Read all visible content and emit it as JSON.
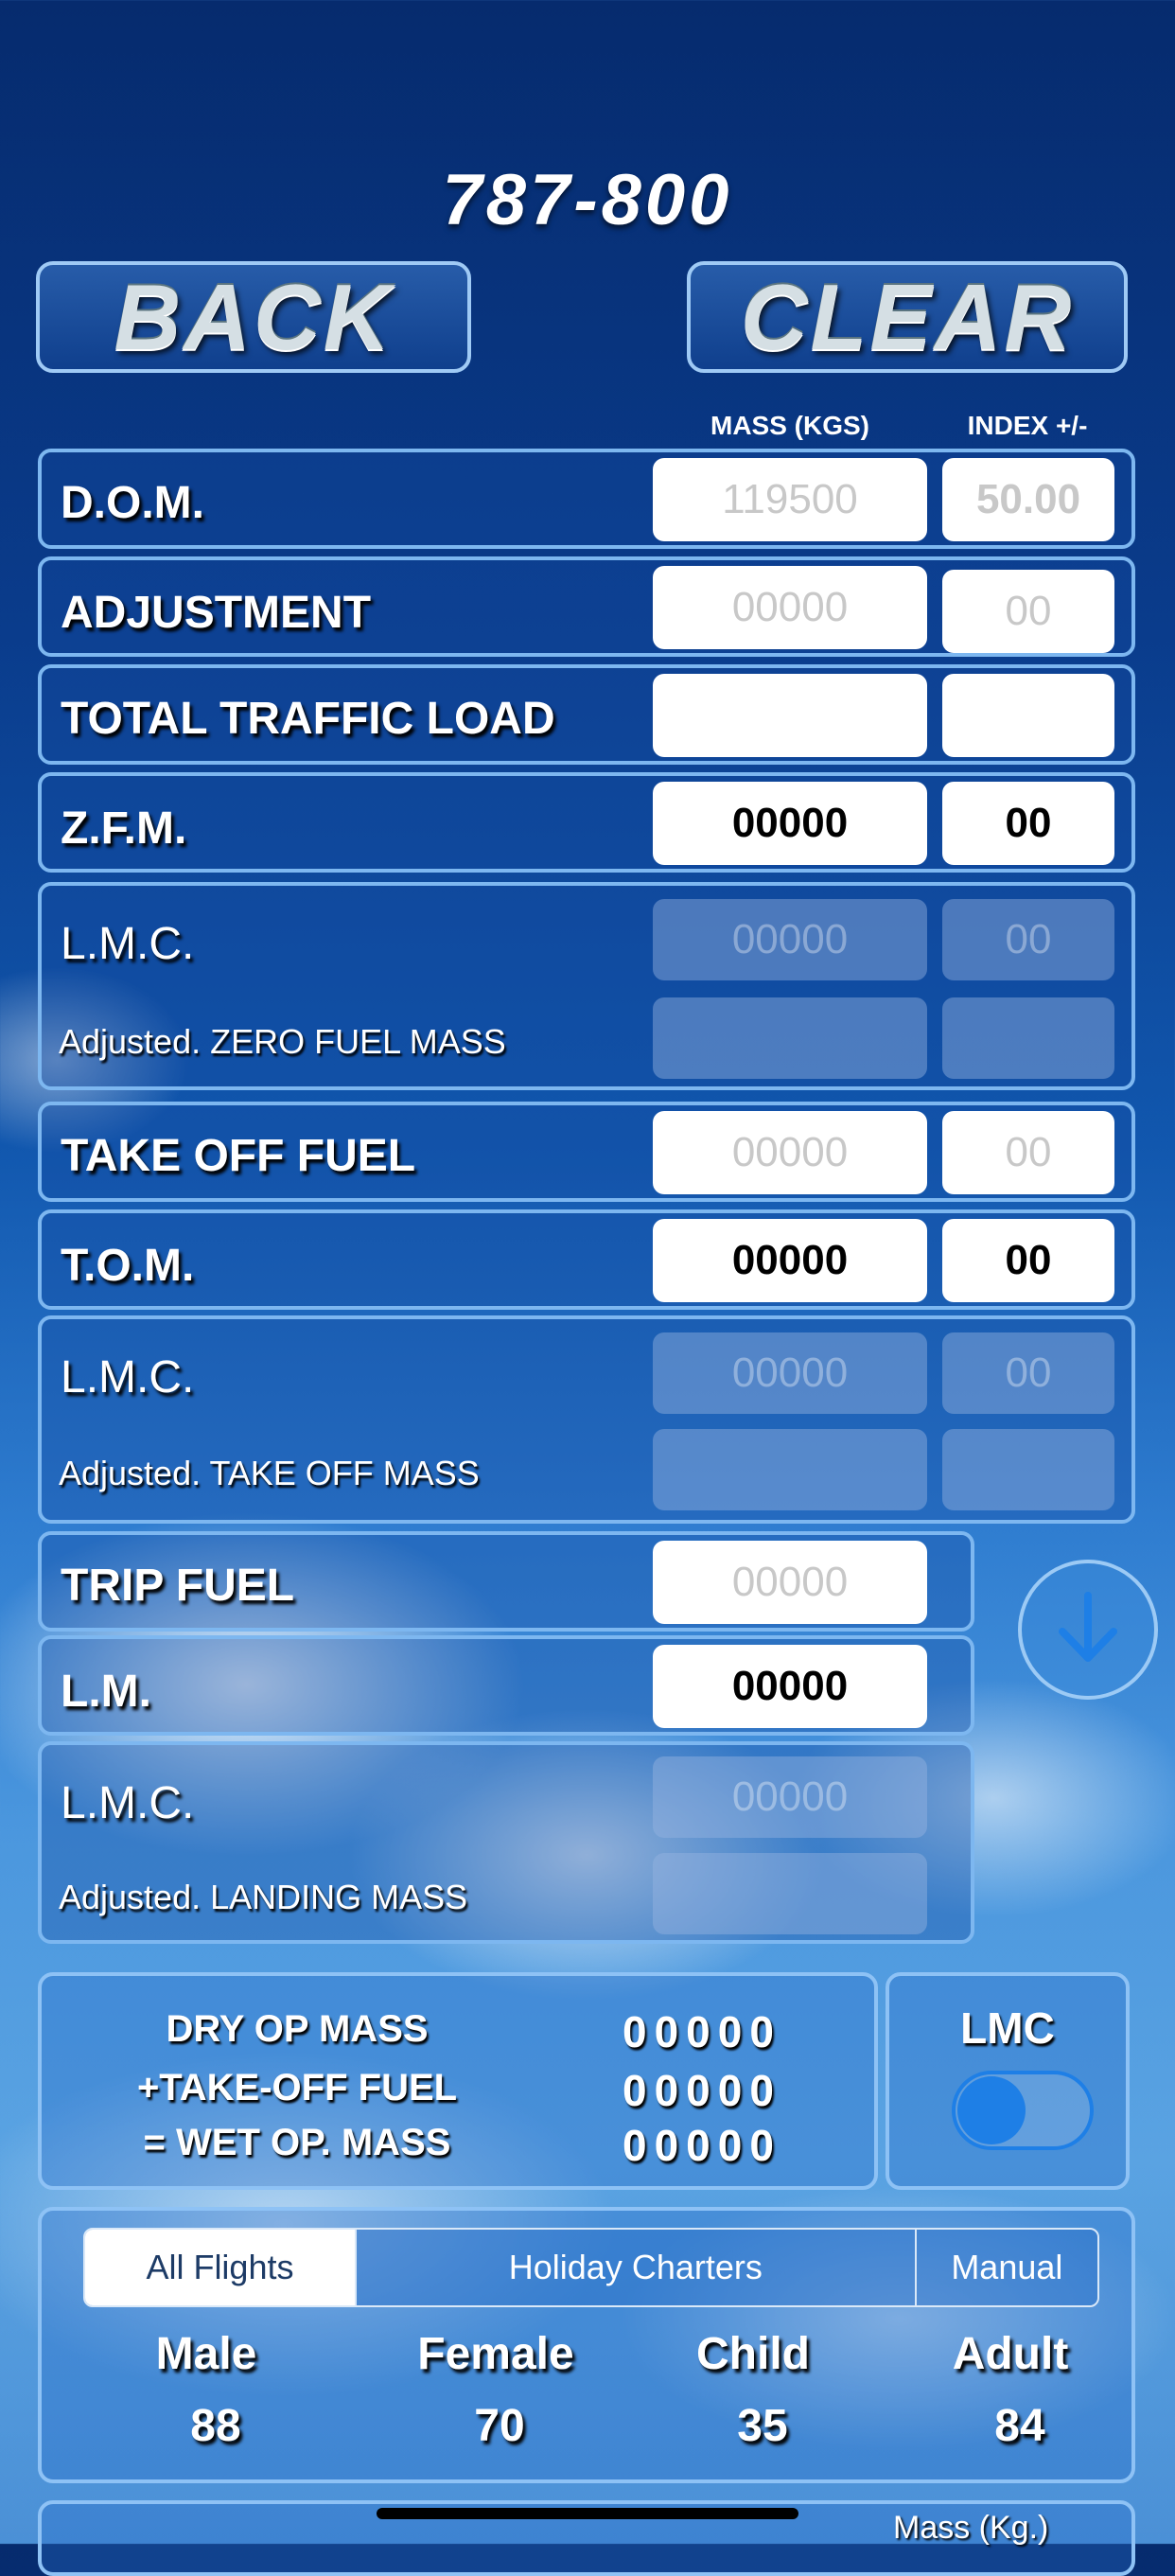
{
  "header": {
    "title": "787-800",
    "back_label": "BACK",
    "clear_label": "CLEAR"
  },
  "columns": {
    "mass": "MASS (KGS)",
    "index": "INDEX +/-"
  },
  "rows": {
    "dom": {
      "label": "D.O.M.",
      "mass": "119500",
      "index": "50.00"
    },
    "adjustment": {
      "label": "ADJUSTMENT",
      "mass_placeholder": "00000",
      "index_placeholder": "00"
    },
    "ttl": {
      "label": "TOTAL TRAFFIC LOAD",
      "mass": "",
      "index": ""
    },
    "zfm": {
      "label": "Z.F.M.",
      "mass": "00000",
      "index": "00"
    },
    "lmc_zfm": {
      "label": "L.M.C.",
      "sublabel": "Adjusted. ZERO FUEL MASS",
      "mass": "00000",
      "index": "00"
    },
    "tof": {
      "label": "TAKE OFF FUEL",
      "mass_placeholder": "00000",
      "index_placeholder": "00"
    },
    "tom": {
      "label": "T.O.M.",
      "mass": "00000",
      "index": "00"
    },
    "lmc_tom": {
      "label": "L.M.C.",
      "sublabel": "Adjusted. TAKE OFF MASS",
      "mass": "00000",
      "index": "00"
    },
    "trip": {
      "label": "TRIP FUEL",
      "mass_placeholder": "00000"
    },
    "lm": {
      "label": "L.M.",
      "mass": "00000"
    },
    "lmc_lm": {
      "label": "L.M.C.",
      "sublabel": "Adjusted. LANDING MASS",
      "mass": "00000"
    }
  },
  "summary": {
    "dry_label": "DRY OP MASS",
    "dry_value": "00000",
    "tof_label": "+TAKE-OFF FUEL",
    "tof_value": "00000",
    "wet_label": "= WET OP. MASS",
    "wet_value": "00000"
  },
  "lmc_toggle": {
    "label": "LMC",
    "on": true
  },
  "pax": {
    "tabs": [
      "All Flights",
      "Holiday Charters",
      "Manual"
    ],
    "selected_tab": "All Flights",
    "headers": [
      "Male",
      "Female",
      "Child",
      "Adult"
    ],
    "values": [
      "88",
      "70",
      "35",
      "84"
    ]
  },
  "footer": {
    "mass_label": "Mass (Kg.)"
  },
  "colors": {
    "accent": "#1e7fe6",
    "panel_border": "#7db7f0"
  },
  "icons": {
    "scroll": "arrow-down-icon"
  }
}
